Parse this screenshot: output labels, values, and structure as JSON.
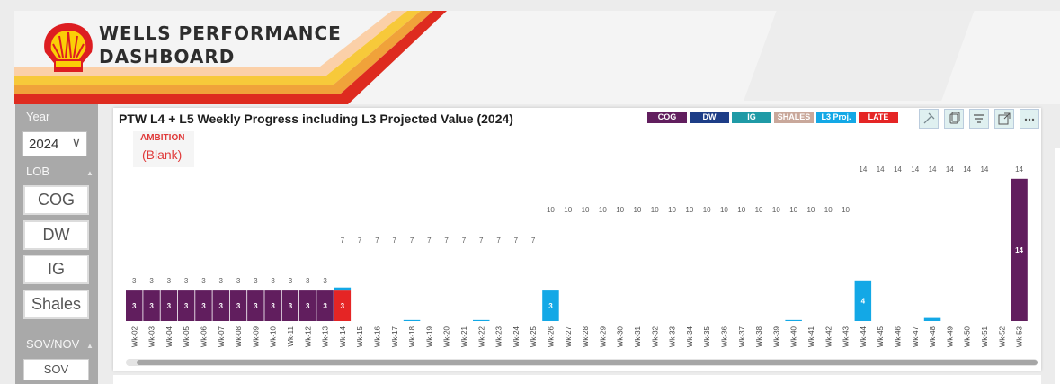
{
  "header": {
    "title_line1": "WELLS PERFORMANCE",
    "title_line2": "DASHBOARD"
  },
  "sidebar": {
    "year_label": "Year",
    "year_value": "2024",
    "lob_label": "LOB",
    "lob_options": [
      "COG",
      "DW",
      "IG",
      "Shales"
    ],
    "sov_label": "SOV/NOV",
    "sov_option": "SOV"
  },
  "visual": {
    "title": "PTW L4 + L5 Weekly Progress including L3 Projected Value (2024)",
    "legend": [
      {
        "label": "COG",
        "color": "#611e5e"
      },
      {
        "label": "DW",
        "color": "#1d3d87"
      },
      {
        "label": "IG",
        "color": "#1f9aa6"
      },
      {
        "label": "SHALES",
        "color": "#c9a89b"
      },
      {
        "label": "L3 Proj.",
        "color": "#13a8e6"
      },
      {
        "label": "LATE",
        "color": "#e52525"
      }
    ],
    "toolbar": [
      "pin-icon",
      "copy-icon",
      "filter-icon",
      "focus-mode-icon",
      "more-options-icon"
    ],
    "ambition_title": "AMBITION",
    "ambition_value": "(Blank)"
  },
  "colors": {
    "cog": "#611e5e",
    "late": "#e52525",
    "l3proj": "#13a8e6",
    "label": "#5c5c5c"
  },
  "chart_data": {
    "type": "bar",
    "stacked": true,
    "title": "PTW L4 + L5 Weekly Progress including L3 Projected Value (2024)",
    "categories": [
      "Wk-02",
      "Wk-03",
      "Wk-04",
      "Wk-05",
      "Wk-06",
      "Wk-07",
      "Wk-08",
      "Wk-09",
      "Wk-10",
      "Wk-11",
      "Wk-12",
      "Wk-13",
      "Wk-14",
      "Wk-15",
      "Wk-16",
      "Wk-17",
      "Wk-18",
      "Wk-19",
      "Wk-20",
      "Wk-21",
      "Wk-22",
      "Wk-23",
      "Wk-24",
      "Wk-25",
      "Wk-26",
      "Wk-27",
      "Wk-28",
      "Wk-29",
      "Wk-30",
      "Wk-31",
      "Wk-32",
      "Wk-33",
      "Wk-34",
      "Wk-35",
      "Wk-36",
      "Wk-37",
      "Wk-38",
      "Wk-39",
      "Wk-40",
      "Wk-41",
      "Wk-42",
      "Wk-43",
      "Wk-44",
      "Wk-45",
      "Wk-46",
      "Wk-47",
      "Wk-48",
      "Wk-49",
      "Wk-50",
      "Wk-51",
      "Wk-52",
      "Wk-53"
    ],
    "series": [
      {
        "name": "COG",
        "values": [
          3,
          3,
          3,
          3,
          3,
          3,
          3,
          3,
          3,
          3,
          3,
          3,
          0,
          0,
          0,
          0,
          0,
          0,
          0,
          0,
          0,
          0,
          0,
          0,
          0,
          0,
          0,
          0,
          0,
          0,
          0,
          0,
          0,
          0,
          0,
          0,
          0,
          0,
          0,
          0,
          0,
          0,
          0,
          0,
          0,
          0,
          0,
          0,
          0,
          0,
          0,
          14
        ]
      },
      {
        "name": "LATE",
        "values": [
          0,
          0,
          0,
          0,
          0,
          0,
          0,
          0,
          0,
          0,
          0,
          0,
          3,
          0,
          0,
          0,
          0,
          0,
          0,
          0,
          0,
          0,
          0,
          0,
          0,
          0,
          0,
          0,
          0,
          0,
          0,
          0,
          0,
          0,
          0,
          0,
          0,
          0,
          0,
          0,
          0,
          0,
          0,
          0,
          0,
          0,
          0,
          0,
          0,
          0,
          0,
          0
        ]
      },
      {
        "name": "L3 Proj.",
        "values": [
          0,
          0,
          0,
          0,
          0,
          0,
          0,
          0,
          0,
          0,
          0,
          0,
          0.3,
          0,
          0,
          0,
          0.1,
          0,
          0,
          0,
          0.1,
          0,
          0,
          0,
          3,
          0,
          0,
          0,
          0,
          0,
          0,
          0,
          0,
          0,
          0,
          0,
          0,
          0,
          0.1,
          0,
          0,
          0,
          4,
          0,
          0,
          0,
          0.3,
          0,
          0,
          0,
          0,
          0
        ]
      }
    ],
    "segment_labels": [
      3,
      3,
      3,
      3,
      3,
      3,
      3,
      3,
      3,
      3,
      3,
      3,
      3,
      null,
      null,
      null,
      null,
      null,
      null,
      null,
      null,
      null,
      null,
      null,
      3,
      null,
      null,
      null,
      null,
      null,
      null,
      null,
      null,
      null,
      null,
      null,
      null,
      null,
      null,
      null,
      null,
      null,
      4,
      null,
      null,
      null,
      null,
      null,
      null,
      null,
      null,
      14
    ],
    "cumulative_labels": [
      3,
      3,
      3,
      3,
      3,
      3,
      3,
      3,
      3,
      3,
      3,
      3,
      7,
      7,
      7,
      7,
      7,
      7,
      7,
      7,
      7,
      7,
      7,
      7,
      10,
      10,
      10,
      10,
      10,
      10,
      10,
      10,
      10,
      10,
      10,
      10,
      10,
      10,
      10,
      10,
      10,
      10,
      14,
      14,
      14,
      14,
      14,
      14,
      14,
      14,
      null,
      14
    ],
    "ylim": [
      0,
      14.5
    ],
    "legend_position": "top-right",
    "grid": false
  }
}
